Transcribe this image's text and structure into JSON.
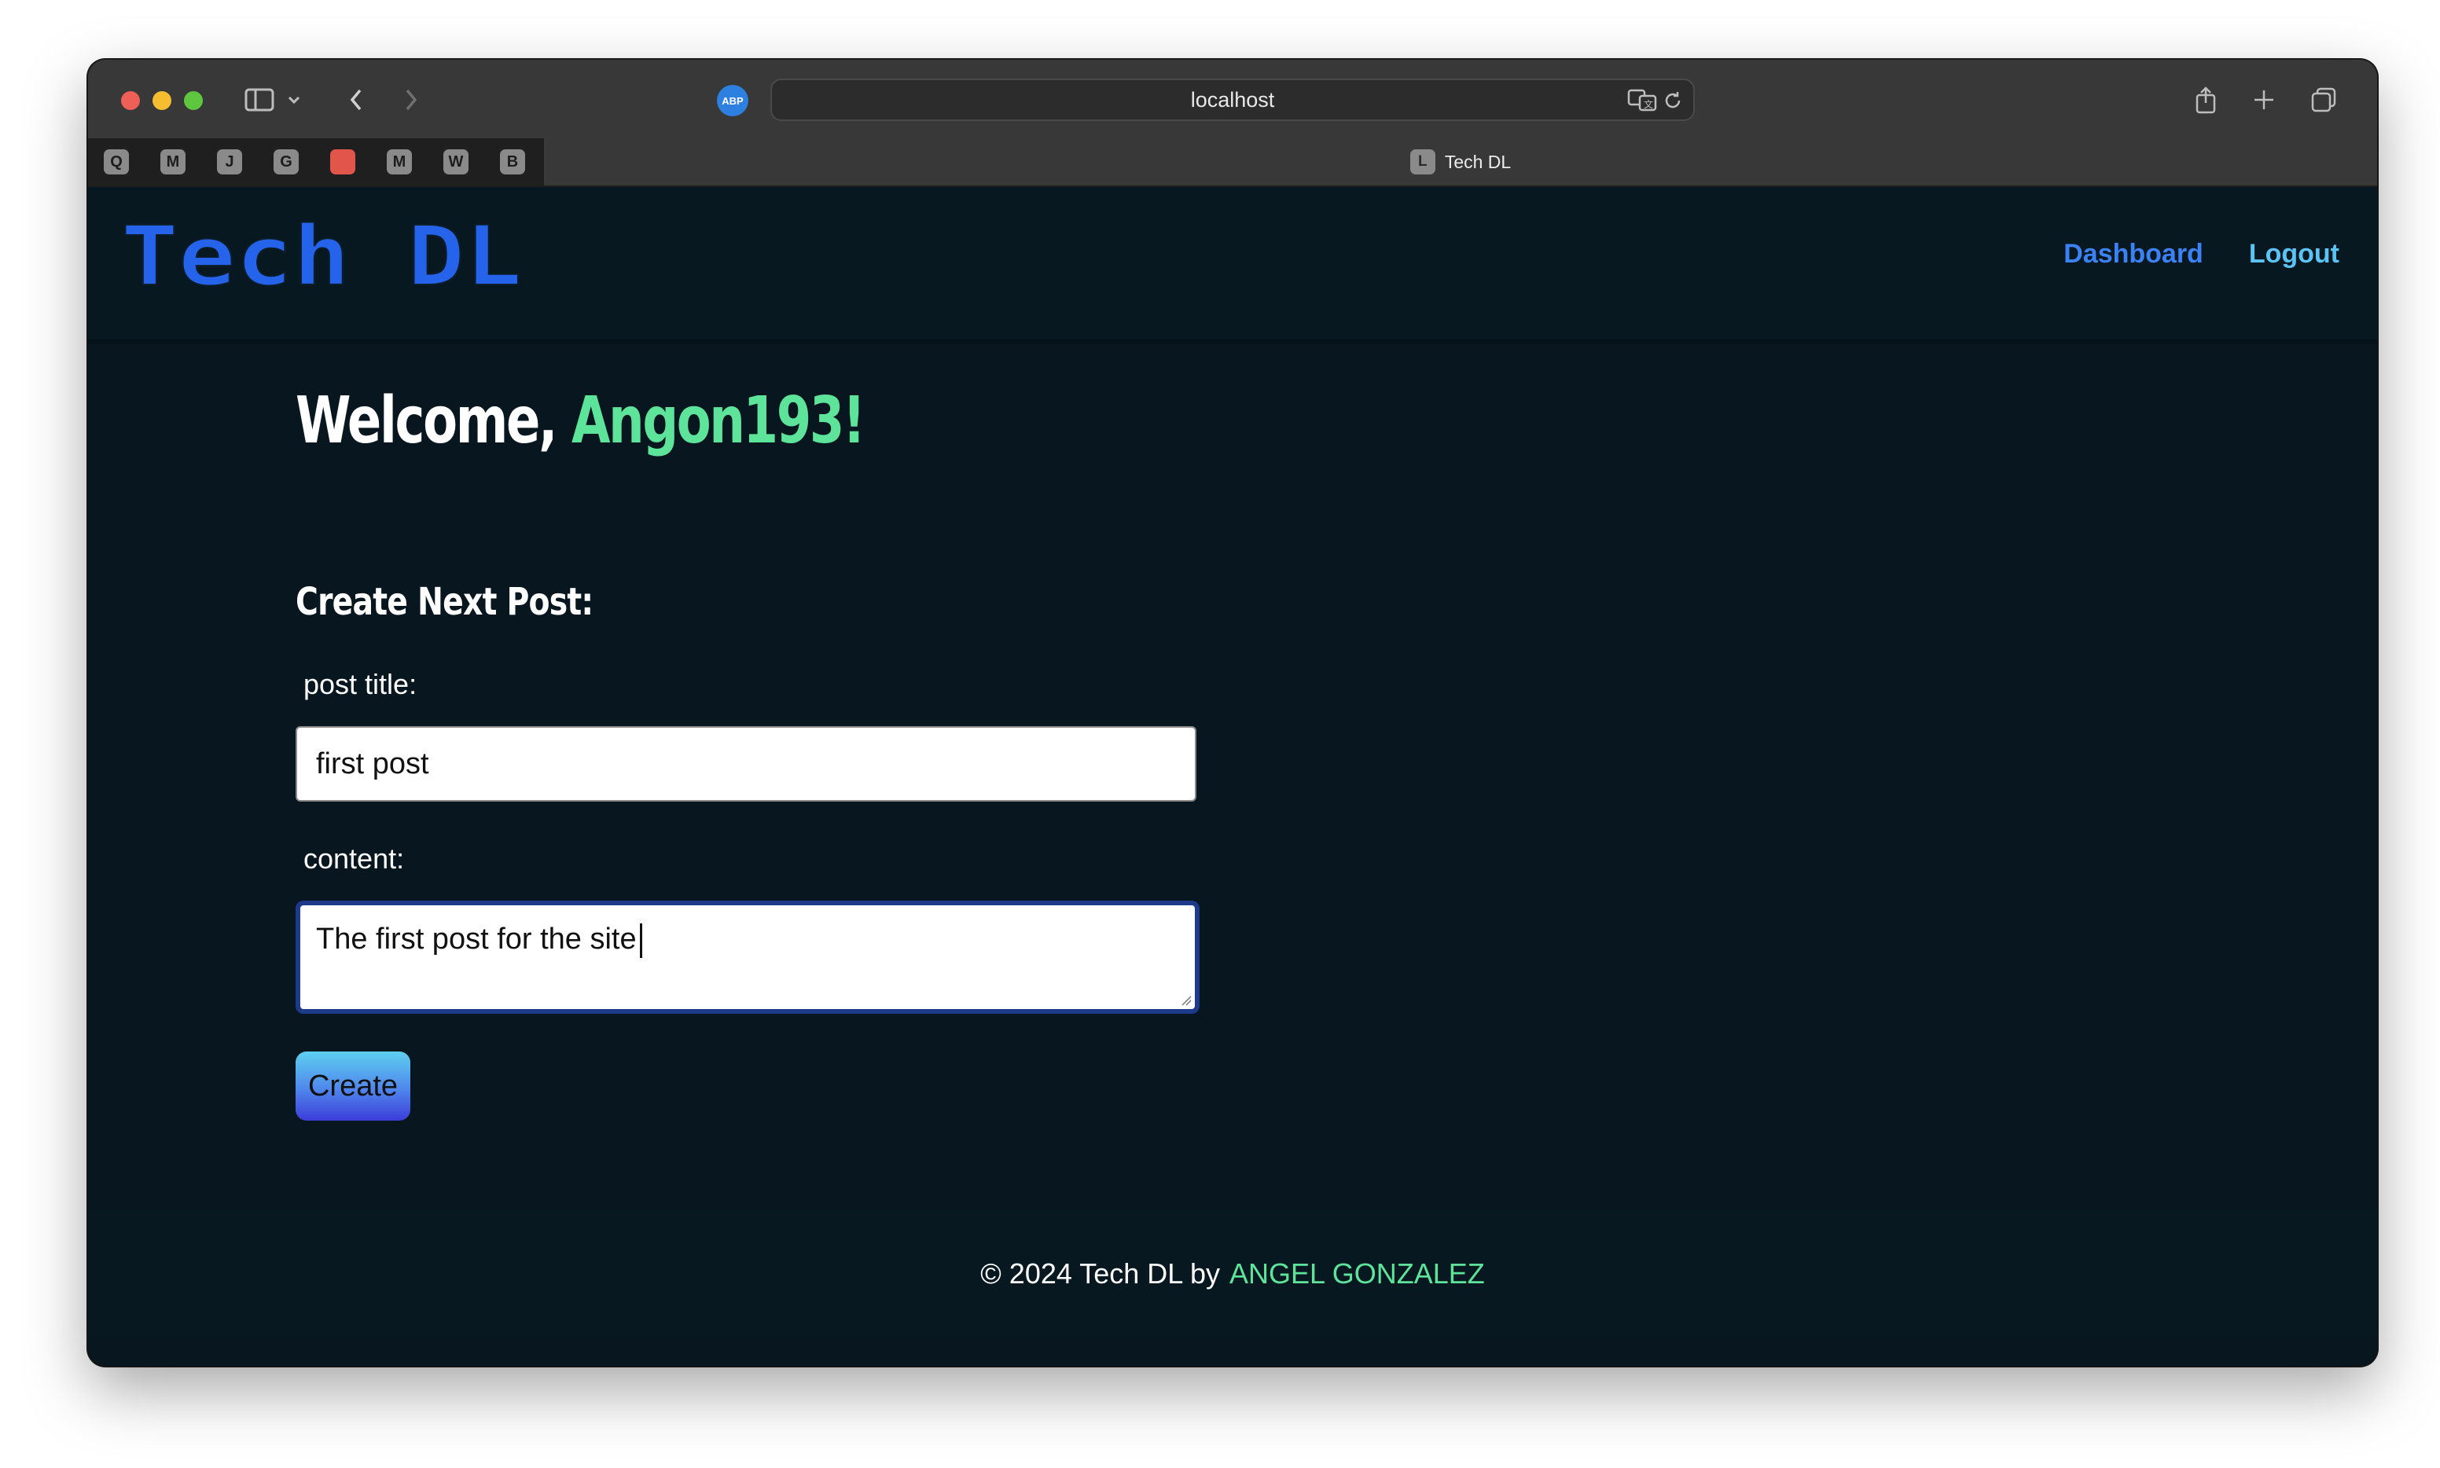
{
  "browser": {
    "url": "localhost",
    "active_tab_title": "Tech DL",
    "active_tab_favicon": "L",
    "abp_label": "ABP",
    "pinned_tabs": [
      "Q",
      "M",
      "J",
      "G",
      "",
      "M",
      "W",
      "B"
    ]
  },
  "site": {
    "logo_text": "Tech DL",
    "nav": {
      "dashboard": "Dashboard",
      "logout": "Logout"
    },
    "welcome_prefix": "Welcome, ",
    "username": "Angon193!",
    "form_heading": "Create Next Post:",
    "title_label": "post title:",
    "title_value": "first post",
    "content_label": "content:",
    "content_value": "The first post for the site",
    "submit_label": "Create",
    "footer_prefix": "© 2024 Tech DL by",
    "footer_author": "ANGEL GONZALEZ"
  },
  "colors": {
    "page_bg": "#08171f",
    "logo_blue": "#2563eb",
    "accent_green": "#5ee49a",
    "nav_blue": "#3b82f6"
  }
}
